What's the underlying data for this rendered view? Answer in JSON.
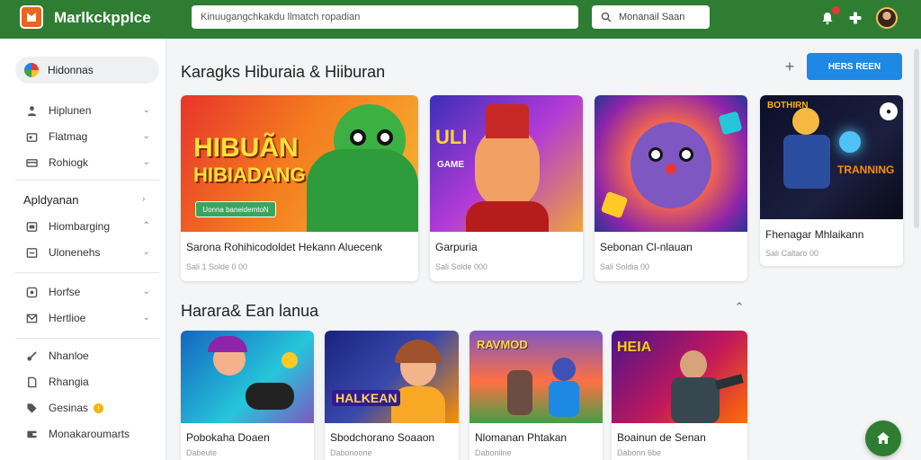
{
  "header": {
    "brand": "Marlkckpplce",
    "search_placeholder": "Kinuugangchkakdu llmatch ropadian",
    "search2_label": "Monanail Saan"
  },
  "sidebar": {
    "pill_label": "Hidonnas",
    "items_top": [
      {
        "label": "Hiplunen",
        "icon": "person-icon"
      },
      {
        "label": "Flatmag",
        "icon": "store-icon"
      },
      {
        "label": "Rohiogk",
        "icon": "card-icon"
      }
    ],
    "heading": "Apldyanan",
    "items_mid": [
      {
        "label": "Hiombarging",
        "icon": "phone-icon"
      },
      {
        "label": "Ulonenehs",
        "icon": "screen-icon"
      }
    ],
    "items_lower": [
      {
        "label": "Horfse",
        "icon": "settings-icon"
      },
      {
        "label": "Hertlioe",
        "icon": "mail-icon"
      }
    ],
    "items_bottom": [
      {
        "label": "Nhanloe",
        "icon": "key-icon"
      },
      {
        "label": "Rhangia",
        "icon": "doc-icon"
      },
      {
        "label": "Gesinas",
        "icon": "tag-icon",
        "badge": "!"
      },
      {
        "label": "Monakaroumarts",
        "icon": "wallet-icon"
      }
    ]
  },
  "section1": {
    "title": "Karagks Hiburaia & Hiiburan",
    "cta_label": "HERS REEN",
    "cards": [
      {
        "title": "Sarona Rohihicodoldet Hekann Aluecenk",
        "subtitle": "Sali 1 Solde 0 00",
        "art_text": "HIBUÃN",
        "art_text2": "HIBIADANG",
        "art_button": "Uonna baneidemtoN"
      },
      {
        "title": "Garpuria",
        "subtitle": "Sali Solde 000",
        "art_text": "ULI",
        "art_text2": "GAME"
      },
      {
        "title": "Sebonan Cl-nlauan",
        "subtitle": "Sali Soldia 00"
      },
      {
        "title": "Fhenagar Mhlaikann",
        "subtitle": "Sali Caltaro 00",
        "art_text": "TRANNING",
        "art_text2": "BOTHIRN"
      }
    ]
  },
  "section2": {
    "title": "Harara& Ean lanua",
    "cards": [
      {
        "title": "Pobokaha Doaen",
        "subtitle": "Dabeute"
      },
      {
        "title": "Sbodchorano Soaaon",
        "subtitle": "Dabonoone",
        "art_text": "HALKEAN"
      },
      {
        "title": "Nlomanan Phtakan",
        "subtitle": "Dabonilne",
        "art_text": "RAVMOD"
      },
      {
        "title": "Boainun de Senan",
        "subtitle": "Dabonn 6be",
        "art_text": "HEIA"
      }
    ]
  }
}
